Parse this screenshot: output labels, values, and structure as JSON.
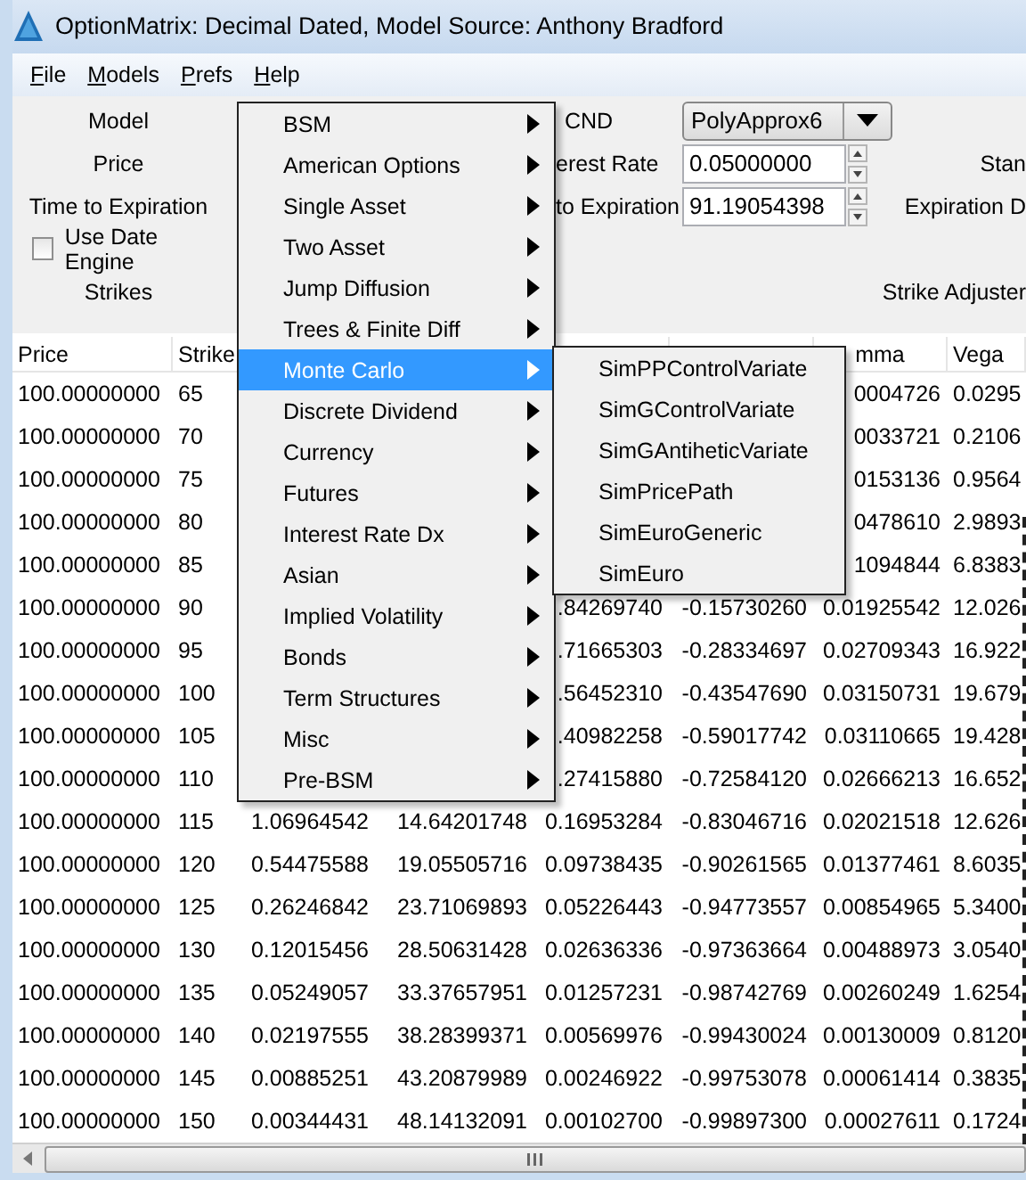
{
  "window": {
    "title": "OptionMatrix: Decimal Dated, Model Source: Anthony Bradford"
  },
  "menu_bar": [
    {
      "label": "File"
    },
    {
      "label": "Models"
    },
    {
      "label": "Prefs"
    },
    {
      "label": "Help"
    }
  ],
  "form": {
    "left_labels": [
      "Model",
      "Price",
      "Time to Expiration"
    ],
    "use_date_engine": {
      "label": "Use Date Engine",
      "checked": false
    },
    "strikes_label": "Strikes",
    "cnd": {
      "label": "CND",
      "value": "PolyApprox6"
    },
    "interest_rate": {
      "label": "erest Rate",
      "value": "0.05000000"
    },
    "time_to_expiration": {
      "label": "to Expiration",
      "value": "91.19054398"
    },
    "right_labels": [
      "Stan",
      "Expiration D"
    ],
    "strike_adjuster_label": "Strike Adjuster"
  },
  "table": {
    "header": {
      "price": "Price",
      "strike": "Strike",
      "column_7": "mma",
      "column_8": "Vega"
    },
    "rows": [
      {
        "price": "100.00000000",
        "strike": "65",
        "column_7": "0004726",
        "column_8": "0.0295"
      },
      {
        "price": "100.00000000",
        "strike": "70",
        "column_7": "0033721",
        "column_8": "0.2106"
      },
      {
        "price": "100.00000000",
        "strike": "75",
        "column_7": "0153136",
        "column_8": "0.9564"
      },
      {
        "price": "100.00000000",
        "strike": "80",
        "column_7": "0478610",
        "column_8": "2.9893"
      },
      {
        "price": "100.00000000",
        "strike": "85",
        "column_7": "1094844",
        "column_8": "6.8383"
      },
      {
        "price": "100.00000000",
        "strike": "90",
        "column_5": ".84269740",
        "column_6": "-0.15730260",
        "column_7": "0.01925542",
        "column_8": "12.026"
      },
      {
        "price": "100.00000000",
        "strike": "95",
        "column_5": ".71665303",
        "column_6": "-0.28334697",
        "column_7": "0.02709343",
        "column_8": "16.922"
      },
      {
        "price": "100.00000000",
        "strike": "100",
        "column_5": ".56452310",
        "column_6": "-0.43547690",
        "column_7": "0.03150731",
        "column_8": "19.679"
      },
      {
        "price": "100.00000000",
        "strike": "105",
        "column_5": ".40982258",
        "column_6": "-0.59017742",
        "column_7": "0.03110665",
        "column_8": "19.428"
      },
      {
        "price": "100.00000000",
        "strike": "110",
        "column_5": ".27415880",
        "column_6": "-0.72584120",
        "column_7": "0.02666213",
        "column_8": "16.652"
      },
      {
        "price": "100.00000000",
        "strike": "115",
        "column_3": "1.06964542",
        "column_4": "14.64201748",
        "column_5": "0.16953284",
        "column_6": "-0.83046716",
        "column_7": "0.02021518",
        "column_8": "12.626"
      },
      {
        "price": "100.00000000",
        "strike": "120",
        "column_3": "0.54475588",
        "column_4": "19.05505716",
        "column_5": "0.09738435",
        "column_6": "-0.90261565",
        "column_7": "0.01377461",
        "column_8": "8.6035"
      },
      {
        "price": "100.00000000",
        "strike": "125",
        "column_3": "0.26246842",
        "column_4": "23.71069893",
        "column_5": "0.05226443",
        "column_6": "-0.94773557",
        "column_7": "0.00854965",
        "column_8": "5.3400"
      },
      {
        "price": "100.00000000",
        "strike": "130",
        "column_3": "0.12015456",
        "column_4": "28.50631428",
        "column_5": "0.02636336",
        "column_6": "-0.97363664",
        "column_7": "0.00488973",
        "column_8": "3.0540"
      },
      {
        "price": "100.00000000",
        "strike": "135",
        "column_3": "0.05249057",
        "column_4": "33.37657951",
        "column_5": "0.01257231",
        "column_6": "-0.98742769",
        "column_7": "0.00260249",
        "column_8": "1.6254"
      },
      {
        "price": "100.00000000",
        "strike": "140",
        "column_3": "0.02197555",
        "column_4": "38.28399371",
        "column_5": "0.00569976",
        "column_6": "-0.99430024",
        "column_7": "0.00130009",
        "column_8": "0.8120"
      },
      {
        "price": "100.00000000",
        "strike": "145",
        "column_3": "0.00885251",
        "column_4": "43.20879989",
        "column_5": "0.00246922",
        "column_6": "-0.99753078",
        "column_7": "0.00061414",
        "column_8": "0.3835"
      },
      {
        "price": "100.00000000",
        "strike": "150",
        "column_3": "0.00344431",
        "column_4": "48.14132091",
        "column_5": "0.00102700",
        "column_6": "-0.99897300",
        "column_7": "0.00027611",
        "column_8": "0.1724"
      }
    ]
  },
  "models_menu": {
    "items": [
      {
        "label": "BSM",
        "selected": false
      },
      {
        "label": "American Options",
        "selected": false
      },
      {
        "label": "Single Asset",
        "selected": false
      },
      {
        "label": "Two Asset",
        "selected": false
      },
      {
        "label": "Jump Diffusion",
        "selected": false
      },
      {
        "label": "Trees & Finite Diff",
        "selected": false
      },
      {
        "label": "Monte Carlo",
        "selected": true
      },
      {
        "label": "Discrete Dividend",
        "selected": false
      },
      {
        "label": "Currency",
        "selected": false
      },
      {
        "label": "Futures",
        "selected": false
      },
      {
        "label": "Interest Rate Dx",
        "selected": false
      },
      {
        "label": "Asian",
        "selected": false
      },
      {
        "label": "Implied Volatility",
        "selected": false
      },
      {
        "label": "Bonds",
        "selected": false
      },
      {
        "label": "Term Structures",
        "selected": false
      },
      {
        "label": "Misc",
        "selected": false
      },
      {
        "label": "Pre-BSM",
        "selected": false
      }
    ]
  },
  "monte_carlo_submenu": {
    "items": [
      {
        "label": "SimPPControlVariate",
        "selected": false
      },
      {
        "label": "SimGControlVariate",
        "selected": false
      },
      {
        "label": "SimGAntiheticVariate",
        "selected": false
      },
      {
        "label": "SimPricePath",
        "selected": false
      },
      {
        "label": "SimEuroGeneric",
        "selected": false
      },
      {
        "label": "SimEuro",
        "selected": false
      }
    ]
  }
}
